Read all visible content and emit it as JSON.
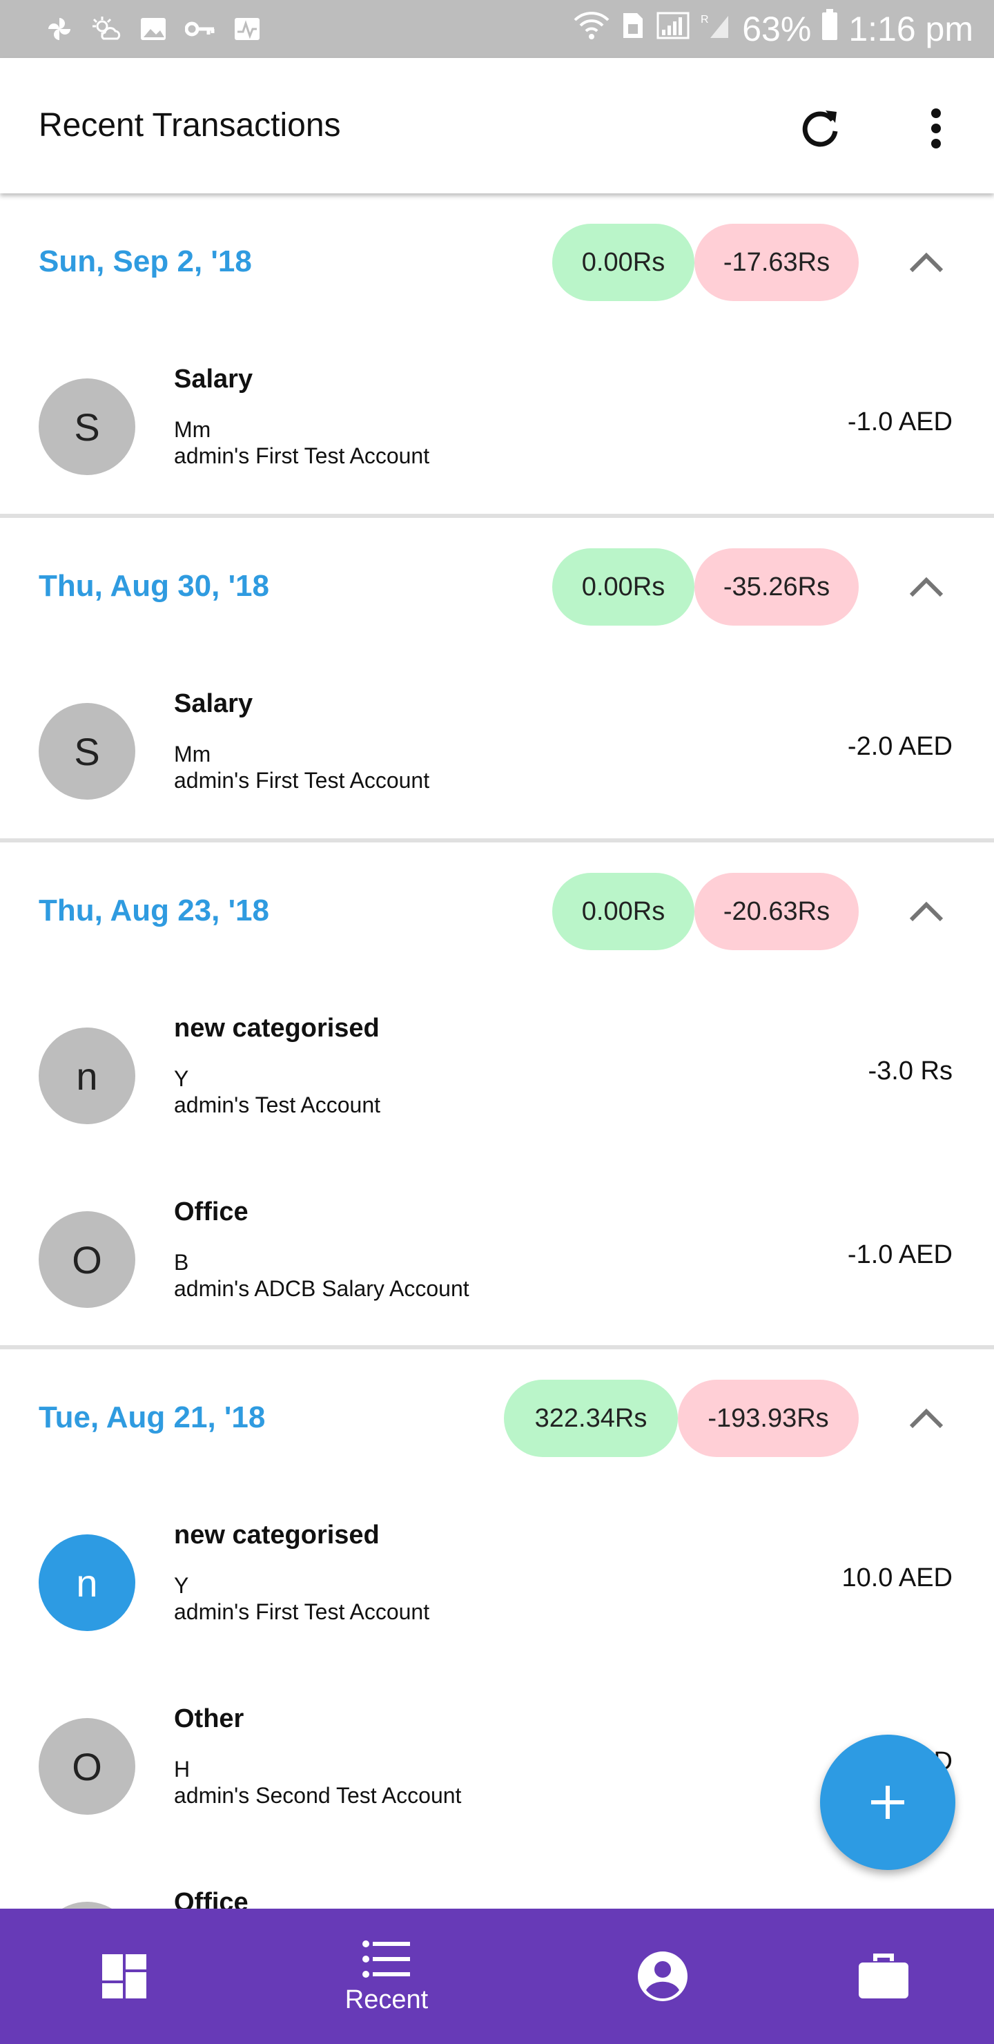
{
  "status_bar": {
    "battery": "63%",
    "time": "1:16 pm"
  },
  "app_bar": {
    "title": "Recent Transactions"
  },
  "groups": [
    {
      "date": "Sun, Sep 2, '18",
      "income": "0.00Rs",
      "expense": "-17.63Rs",
      "transactions": [
        {
          "initial": "S",
          "category": "Salary",
          "note": "Mm",
          "account": "admin's First Test Account",
          "amount": "-1.0 AED"
        }
      ]
    },
    {
      "date": "Thu, Aug 30, '18",
      "income": "0.00Rs",
      "expense": "-35.26Rs",
      "transactions": [
        {
          "initial": "S",
          "category": "Salary",
          "note": "Mm",
          "account": "admin's First Test Account",
          "amount": "-2.0 AED"
        }
      ]
    },
    {
      "date": "Thu, Aug 23, '18",
      "income": "0.00Rs",
      "expense": "-20.63Rs",
      "transactions": [
        {
          "initial": "n",
          "category": "new categorised",
          "note": "Y",
          "account": "admin's Test Account",
          "amount": "-3.0 Rs"
        },
        {
          "initial": "O",
          "category": "Office",
          "note": "B",
          "account": "admin's ADCB Salary Account",
          "amount": "-1.0 AED"
        }
      ]
    },
    {
      "date": "Tue, Aug 21, '18",
      "income": "322.34Rs",
      "expense": "-193.93Rs",
      "transactions": [
        {
          "initial": "n",
          "category": "new categorised",
          "note": "Y",
          "account": "admin's First Test Account",
          "amount": "10.0 AED"
        },
        {
          "initial": "O",
          "category": "Other",
          "note": "H",
          "account": "admin's Second Test Account",
          "amount": "D"
        },
        {
          "initial": "",
          "category": "Office",
          "note": "",
          "account": "",
          "amount": ""
        }
      ]
    }
  ],
  "bottom_nav": {
    "recent_label": "Recent"
  },
  "colors": {
    "accent_blue": "#2d9be3",
    "date_blue": "#2f9be0",
    "nav_purple": "#673ab7",
    "income_green": "#baf5c9",
    "expense_pink": "#ffcfd6",
    "avatar_grey": "#bdbdbd"
  }
}
